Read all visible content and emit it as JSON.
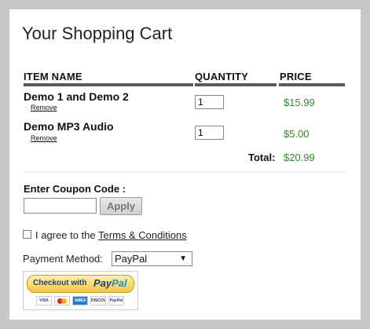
{
  "cart": {
    "title": "Your Shopping Cart",
    "columns": {
      "item": "ITEM NAME",
      "quantity": "QUANTITY",
      "price": "PRICE"
    },
    "items": [
      {
        "name": "Demo 1 and Demo 2",
        "remove_label": "Remove",
        "quantity": "1",
        "price": "$15.99"
      },
      {
        "name": "Demo MP3 Audio",
        "remove_label": "Remove",
        "quantity": "1",
        "price": "$5.00"
      }
    ],
    "total_label": "Total:",
    "total_value": "$20.99"
  },
  "coupon": {
    "label": "Enter Coupon Code :",
    "value": "",
    "apply_label": "Apply"
  },
  "terms": {
    "checked": false,
    "prefix": "I agree to the",
    "link": "Terms & Conditions"
  },
  "payment": {
    "label": "Payment Method:",
    "selected": "PayPal",
    "checkout_button": {
      "prefix": "Checkout with",
      "brand_pay": "Pay",
      "brand_pal": "Pal",
      "cards": [
        "VISA",
        "MasterCard",
        "AMEX",
        "DISCOVER",
        "PayPal"
      ]
    }
  },
  "colors": {
    "price_green": "#2f8a2f",
    "header_rule": "#5b5b5b",
    "paypal_yellow": "#f7c53c",
    "paypal_blue": "#1b3f77"
  }
}
